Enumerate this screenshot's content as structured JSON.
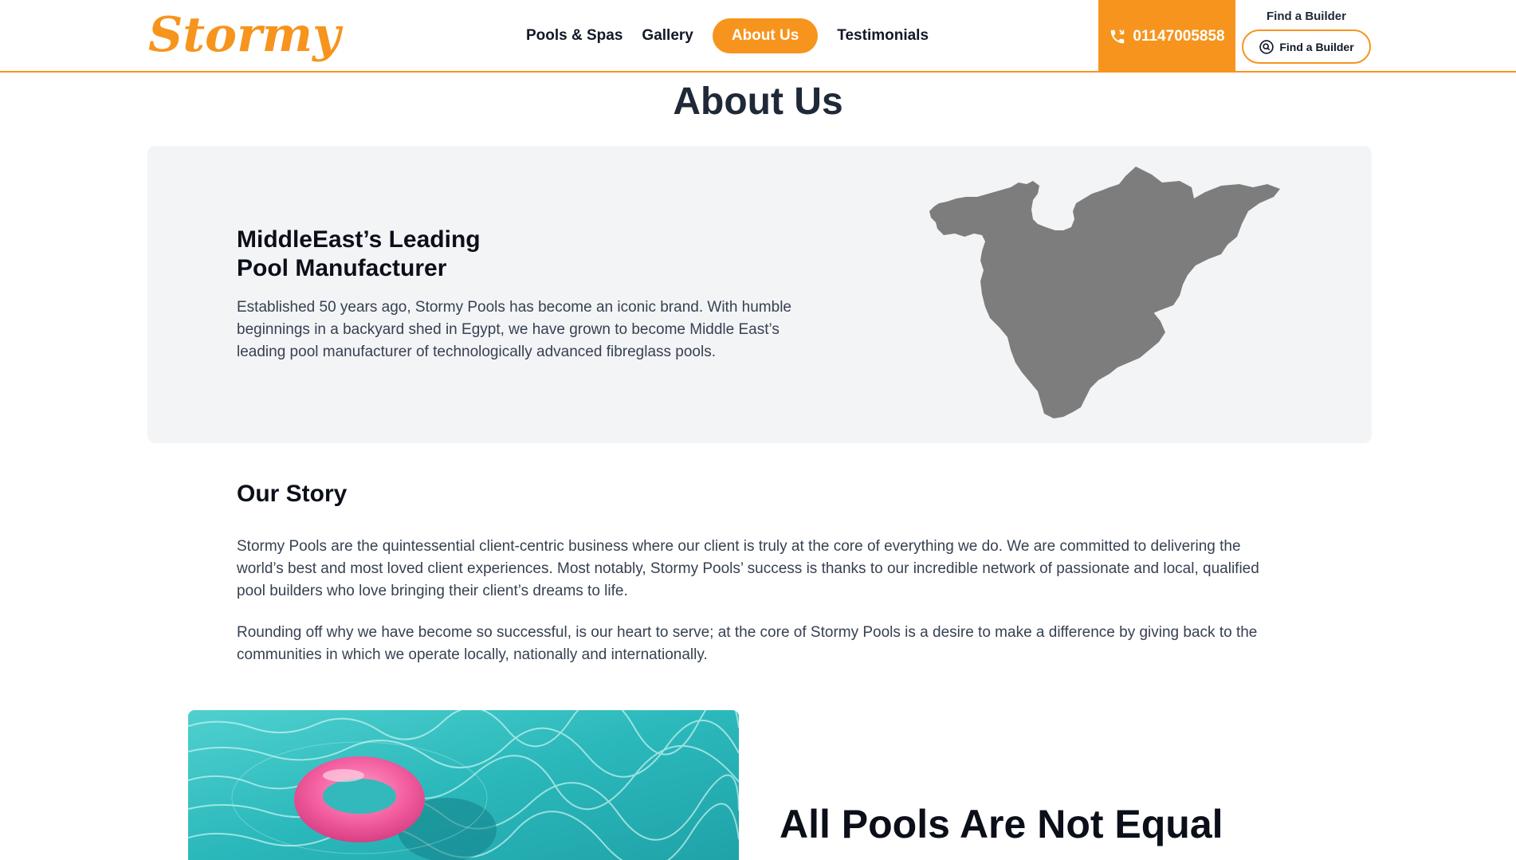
{
  "header": {
    "logo_text": "Stormy",
    "nav": [
      "Pools & Spas",
      "Gallery",
      "About Us",
      "Testimonials"
    ],
    "active_nav": "About Us",
    "phone": "01147005858",
    "find_label": "Find a Builder",
    "find_button": "Find a Builder"
  },
  "page": {
    "title": "About Us"
  },
  "hero": {
    "heading_line1": "MiddleEast’s Leading",
    "heading_line2": "Pool Manufacturer",
    "text": "Established 50 years ago, Stormy Pools has become an iconic brand. With humble beginnings in a backyard shed in Egypt, we have grown to become Middle East’s leading pool manufacturer of technologically advanced fibreglass pools."
  },
  "story": {
    "heading": "Our Story",
    "p1": "Stormy Pools are the quintessential client-centric business where our client is truly at the core of everything we do. We are committed to delivering the world’s best and most loved client experiences. Most notably, Stormy Pools’ success is thanks to our incredible network of passionate and local, qualified pool builders who love bringing their client’s dreams to life.",
    "p2": "Rounding off why we have become so successful, is our heart to serve; at the core of Stormy Pools is a desire to make a difference by giving back to the communities in which we operate locally, nationally and internationally."
  },
  "pools": {
    "heading": "All Pools Are Not Equal"
  },
  "colors": {
    "accent": "#f7941d",
    "panel": "#f3f4f6",
    "map": "#7d7d7d",
    "water": "#3cc3c4",
    "ring": "#f35fa0"
  }
}
